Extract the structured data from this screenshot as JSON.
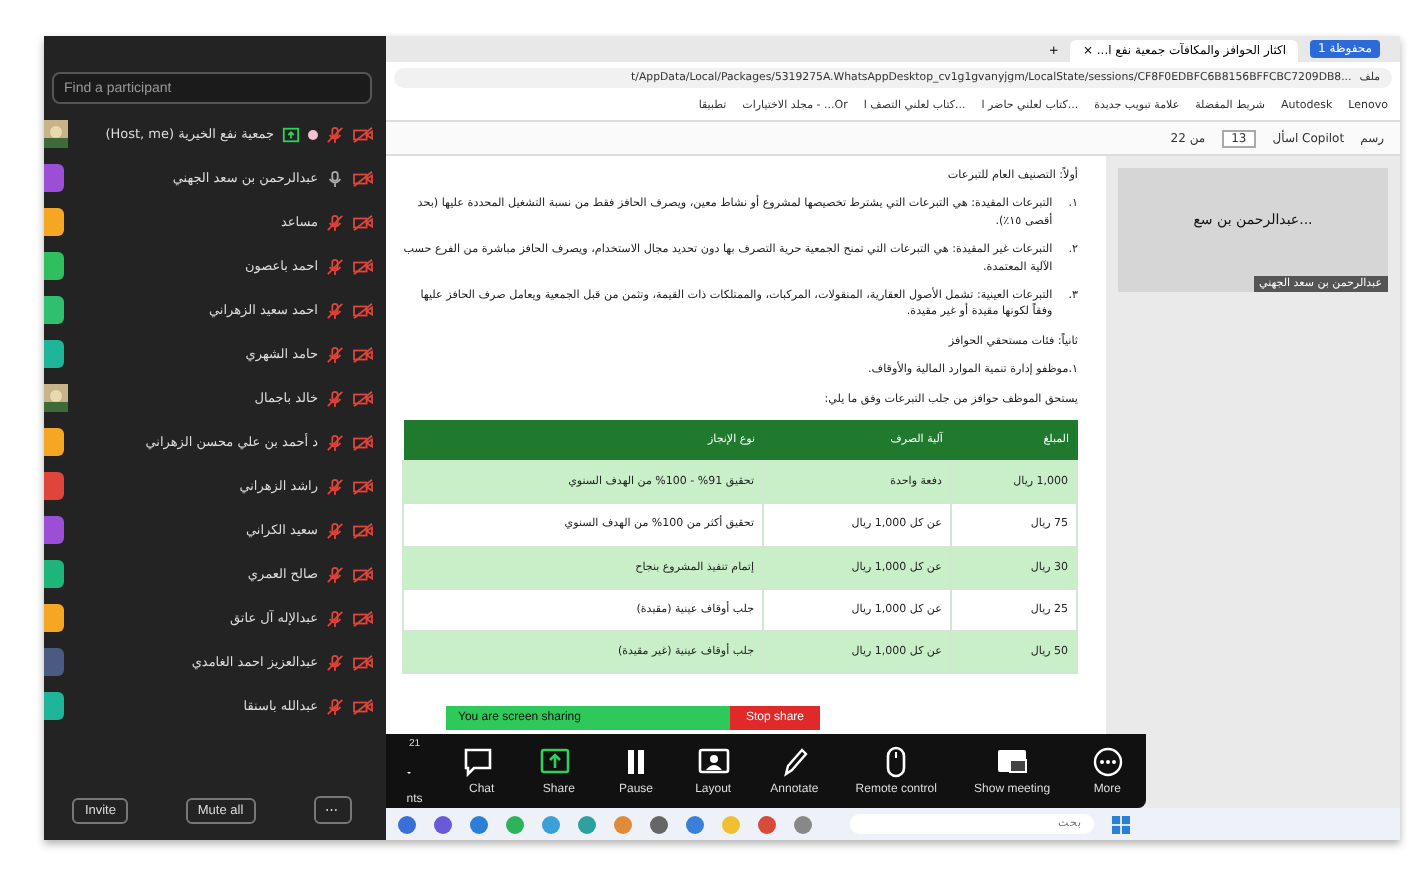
{
  "participants_panel": {
    "search": {
      "placeholder": "Find a participant"
    },
    "participants": [
      {
        "name": "جمعية نفع الخيرية (Host, me)",
        "sharing": true,
        "muted": true,
        "video_off": true
      },
      {
        "name": "عبدالرحمن بن سعد الجهني",
        "kind": "letter",
        "color": "#9b4fd6",
        "sharing": false,
        "muted": false,
        "video_off": true
      },
      {
        "name": "مساعد",
        "kind": "letter",
        "color": "#f5a623",
        "sharing": false,
        "muted": true,
        "video_off": true
      },
      {
        "name": "احمد باعصون",
        "kind": "letter",
        "color": "#2fbf5f",
        "sharing": false,
        "muted": true,
        "video_off": true
      },
      {
        "name": "احمد سعيد الزهراني",
        "kind": "letter",
        "color": "#2fbf6f",
        "sharing": false,
        "muted": true,
        "video_off": true
      },
      {
        "name": "حامد الشهري",
        "kind": "letter",
        "color": "#1fb59a",
        "sharing": false,
        "muted": true,
        "video_off": true
      },
      {
        "name": "خالد باجمال",
        "sharing": false,
        "muted": true,
        "video_off": true
      },
      {
        "name": "د أحمد بن علي محسن الزهراني",
        "kind": "letter",
        "color": "#f5a623",
        "sharing": false,
        "muted": true,
        "video_off": true
      },
      {
        "name": "راشد الزهراني",
        "kind": "letter",
        "color": "#e0443a",
        "sharing": false,
        "muted": true,
        "video_off": true
      },
      {
        "name": "سعيد الكراني",
        "kind": "letter",
        "color": "#9b4fd6",
        "sharing": false,
        "muted": true,
        "video_off": true
      },
      {
        "name": "صالح العمري",
        "kind": "letter",
        "color": "#1fb57a",
        "sharing": false,
        "muted": true,
        "video_off": true
      },
      {
        "name": "عبدالإله آل عاتق",
        "kind": "letter",
        "color": "#f5a623",
        "sharing": false,
        "muted": true,
        "video_off": true
      },
      {
        "name": "عبدالعزيز احمد الغامدي",
        "kind": "letter",
        "color": "#4a5a80",
        "sharing": false,
        "muted": true,
        "video_off": true
      },
      {
        "name": "عبدالله باسنقا",
        "kind": "letter",
        "color": "#1fb59a",
        "sharing": false,
        "muted": true,
        "video_off": true
      }
    ],
    "buttons": [
      "⋯",
      "Mute all",
      "Invite"
    ]
  },
  "browser": {
    "tab_group": "محفوظة 1",
    "tab": {
      "title": "اكثار الحوافز والمكافآت جمعية نفع ا...",
      "close": "×"
    },
    "new_tab": "+",
    "address": {
      "prefix": "ملف",
      "url": "t/AppData/Local/Packages/5319275A.WhatsAppDesktop_cv1g1gvanyjgm/LocalState/sessions/CF8F0EDBFC6B8156BFFCBC7209DB8..."
    },
    "bookmarks": [
      "Lenovo",
      "Autodesk",
      "شريط المفضلة",
      "علامة تبويب جديدة",
      "كتاب لعلني حاضر ا...",
      "كتاب لعلني التصف ا...",
      "مجلد الاختيارات - ...Or",
      "تطبيقا"
    ],
    "pdf_toolbar": {
      "draw": "رسم",
      "copilot": "اسأل Copilot",
      "page": "13",
      "page_count": "من 22"
    }
  },
  "document": {
    "heading": "أولاً: التصنيف العام للتبرعات",
    "items": [
      {
        "number": "١.",
        "text": "التبرعات المقيدة: هي التبرعات التي يشترط تخصيصها لمشروع أو نشاط معين، ويصرف الحافز فقط من نسبة التشغيل المحددة عليها (بحد أقصى ١٥٪)."
      },
      {
        "number": "٢.",
        "text": "التبرعات غير المقيدة: هي التبرعات التي تمنح الجمعية حرية التصرف بها دون تحديد مجال الاستخدام، ويصرف الحافز مباشرة من الفرع حسب الآلية المعتمدة."
      },
      {
        "number": "٣.",
        "text": "التبرعات العينية: تشمل الأصول العقارية، المنقولات، المركبات، والممتلكات ذات القيمة، وتثمن من قبل الجمعية ويعامل صرف الحافز عليها وفقاً لكونها مقيدة أو غير مقيدة."
      }
    ],
    "subheading": "ثانياً: فئات مستحقي الحوافز",
    "group": "١.موظفو إدارة تنمية الموارد المالية والأوقاف.",
    "intro": "يستحق الموظف حوافز من جلب التبرعات وفق ما يلي:",
    "table": {
      "columns": [
        "المبلغ",
        "آلية الصرف",
        "نوع الإنجاز"
      ],
      "rows": [
        [
          "1,000 ريال",
          "دفعة واحدة",
          "تحقيق 91% - 100% من الهدف السنوي"
        ],
        [
          "75 ريال",
          "عن كل 1,000 ريال",
          "تحقيق أكثر من 100% من الهدف السنوي"
        ],
        [
          "30 ريال",
          "عن كل 1,000 ريال",
          "إتمام تنفيذ المشروع بنجاح"
        ],
        [
          "25 ريال",
          "عن كل 1,000 ريال",
          "جلب أوقاف عينية (مقيدة)"
        ],
        [
          "50 ريال",
          "عن كل 1,000 ريال",
          "جلب أوقاف عينية (غير مقيدة)"
        ]
      ]
    }
  },
  "video_tile": {
    "name_short": "...عبدالرحمن بن سع",
    "name": "عبدالرحمن بن سعد الجهني"
  },
  "sharing_bar": {
    "label": "You are screen sharing",
    "stop": "Stop share"
  },
  "meeting_toolbar": {
    "items": [
      {
        "kind": "more",
        "label": "More"
      },
      {
        "kind": "show",
        "label": "Show meeting"
      },
      {
        "kind": "remote",
        "label": "Remote control"
      },
      {
        "kind": "annotate",
        "label": "Annotate"
      },
      {
        "kind": "layout",
        "label": "Layout"
      },
      {
        "kind": "pause",
        "label": "Pause"
      },
      {
        "kind": "share",
        "label": "Share"
      },
      {
        "kind": "chat",
        "label": "Chat"
      },
      {
        "kind": "participants",
        "label": "nts",
        "count": "21"
      }
    ]
  },
  "taskbar": {
    "search_placeholder": "بحث"
  }
}
